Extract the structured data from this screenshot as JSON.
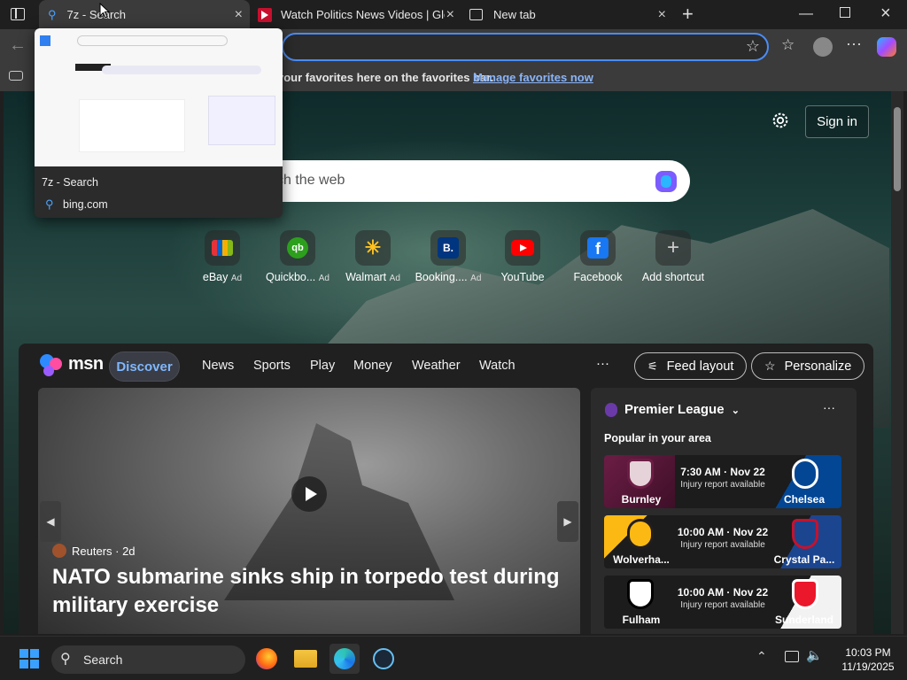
{
  "browser": {
    "tabs": [
      {
        "label": "7z - Search",
        "icon": "bing-search-icon"
      },
      {
        "label": "Watch Politics News Videos | Glo",
        "icon": "global-news-icon"
      },
      {
        "label": "New tab",
        "icon": "new-tab-icon"
      }
    ],
    "favorites_bar": {
      "text": "your favorites here on the favorites bar.",
      "link": "Manage favorites now"
    },
    "tab_preview": {
      "title": "7z - Search",
      "url": "bing.com"
    }
  },
  "newtab": {
    "sign_in": "Sign in",
    "search_placeholder": "ch the web",
    "shortcuts": [
      {
        "label": "eBay",
        "ad": "Ad",
        "icon": "ebay-icon"
      },
      {
        "label": "Quickbo...",
        "ad": "Ad",
        "icon": "quickbooks-icon"
      },
      {
        "label": "Walmart",
        "ad": "Ad",
        "icon": "walmart-icon"
      },
      {
        "label": "Booking....",
        "ad": "Ad",
        "icon": "booking-icon"
      },
      {
        "label": "YouTube",
        "ad": "",
        "icon": "youtube-icon"
      },
      {
        "label": "Facebook",
        "ad": "",
        "icon": "facebook-icon"
      },
      {
        "label": "Add shortcut",
        "ad": "",
        "icon": "plus-icon"
      }
    ]
  },
  "feed": {
    "brand": "msn",
    "nav": [
      "Discover",
      "News",
      "Sports",
      "Play",
      "Money",
      "Weather",
      "Watch"
    ],
    "more": "···",
    "feed_layout": "Feed layout",
    "personalize": "Personalize",
    "hero": {
      "source": "Reuters · 2d",
      "headline": "NATO submarine sinks ship in torpedo test during military exercise"
    },
    "sports": {
      "league": "Premier League",
      "subtitle": "Popular in your area",
      "matches": [
        {
          "home": "Burnley",
          "away": "Chelsea",
          "time": "7:30 AM · Nov 22",
          "note": "Injury report available",
          "home_color": "#6c1d45",
          "away_color": "#034694"
        },
        {
          "home": "Wolverha...",
          "away": "Crystal Pa...",
          "time": "10:00 AM · Nov 22",
          "note": "Injury report available",
          "home_color": "#fdb913",
          "away_color": "#1b458f"
        },
        {
          "home": "Fulham",
          "away": "Sunderland",
          "time": "10:00 AM · Nov 22",
          "note": "Injury report available",
          "home_color": "#ffffff",
          "away_color": "#eb172b"
        }
      ]
    }
  },
  "taskbar": {
    "search": "Search",
    "time": "10:03 PM",
    "date": "11/19/2025"
  }
}
